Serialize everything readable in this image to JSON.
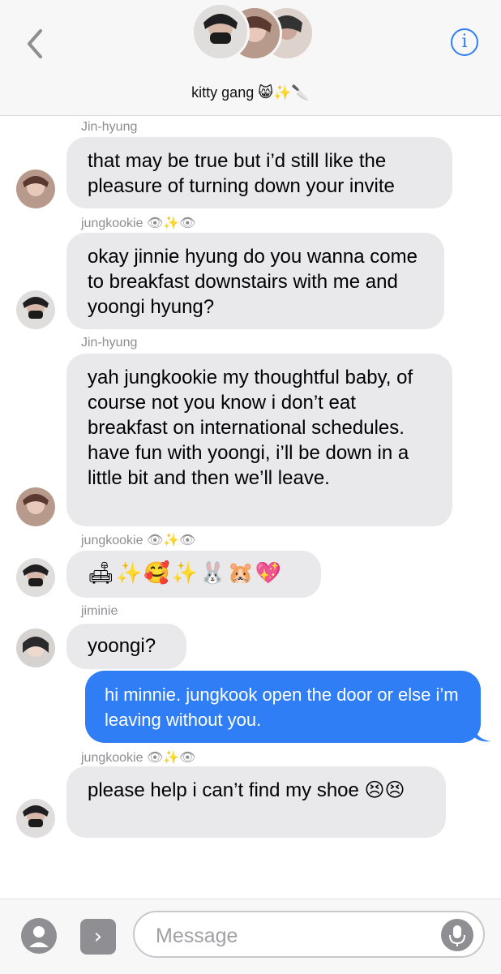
{
  "header": {
    "group_title": "kitty gang 😸✨🔪",
    "back_icon": "chevron-left-icon",
    "info_label": "i"
  },
  "messages": [
    {
      "sender": "Jin-hyung",
      "text": "that may be true but i’d still like the pleasure of turning down your invite"
    },
    {
      "sender": "jungkookie 👁✨👁",
      "text": "okay jinnie hyung do you wanna come to breakfast downstairs with me and yoongi hyung?"
    },
    {
      "sender": "Jin-hyung",
      "text": "yah jungkookie my thoughtful baby, of course not you know i don’t eat breakfast on international schedules. have fun with yoongi, i’ll be down in a little bit and then we’ll leave."
    },
    {
      "sender": "jungkookie 👁✨👁",
      "text": "🛋✨🥰✨🐰🐹💖"
    },
    {
      "sender": "jiminie",
      "text": "yoongi?"
    },
    {
      "sender": "",
      "text": "hi minnie. jungkook open the door or else i’m leaving without you."
    },
    {
      "sender": "jungkookie 👁✨👁",
      "text": "please help i can’t find my shoe 😣😣"
    }
  ],
  "composer": {
    "placeholder": "Message",
    "apps_label": "›",
    "camera_icon": "camera-icon",
    "mic_icon": "microphone-icon"
  },
  "colors": {
    "outgoing_bubble": "#2f7ef6",
    "incoming_bubble": "#e9e9eb",
    "accent": "#2f7ef6"
  }
}
